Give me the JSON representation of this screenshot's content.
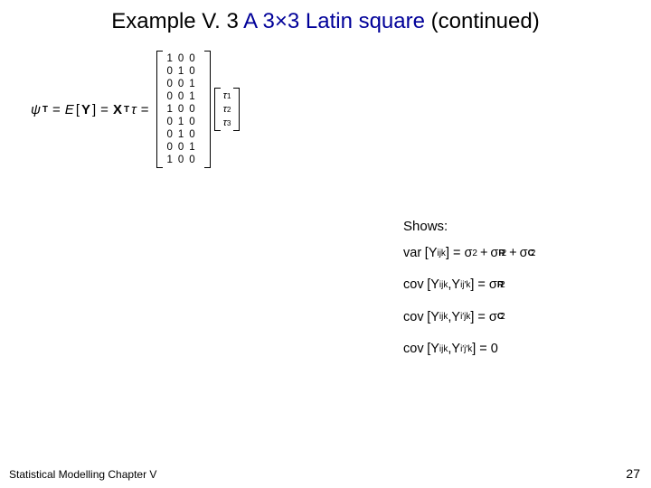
{
  "title": {
    "prefix": "Example V. 3",
    "highlight": "A 3×3 Latin square",
    "suffix": "(continued)"
  },
  "equation": {
    "psi": "ψ",
    "psi_sub": "T",
    "eq": "=",
    "E": "E",
    "Y": "Y",
    "X": "X",
    "X_sub": "T",
    "tau": "τ",
    "design_matrix": [
      [
        "1",
        "0",
        "0"
      ],
      [
        "0",
        "1",
        "0"
      ],
      [
        "0",
        "0",
        "1"
      ],
      [
        "0",
        "0",
        "1"
      ],
      [
        "1",
        "0",
        "0"
      ],
      [
        "0",
        "1",
        "0"
      ],
      [
        "0",
        "1",
        "0"
      ],
      [
        "0",
        "0",
        "1"
      ],
      [
        "1",
        "0",
        "0"
      ]
    ],
    "tau_vector_sub": [
      "1",
      "2",
      "3"
    ]
  },
  "shows_label": "Shows:",
  "formulas": {
    "var": {
      "lhs_fn": "var",
      "arg": "Y",
      "arg_sub": "ijk",
      "rhs_sigma": "σ",
      "rhs_plus": "+",
      "rhs_R": "R",
      "rhs_C": "C",
      "sup2": "2"
    },
    "cov_row": {
      "lhs_fn": "cov",
      "sub1": "ijk",
      "sub2": "ij′k",
      "rhs_R": "R"
    },
    "cov_col": {
      "lhs_fn": "cov",
      "sub1": "ijk",
      "sub2": "i′jk",
      "rhs_C": "C"
    },
    "cov_none": {
      "lhs_fn": "cov",
      "sub1": "ijk",
      "sub2": "i′j′k",
      "rhs_zero": "0"
    }
  },
  "footer": {
    "left": "Statistical Modelling   Chapter V",
    "right": "27"
  }
}
